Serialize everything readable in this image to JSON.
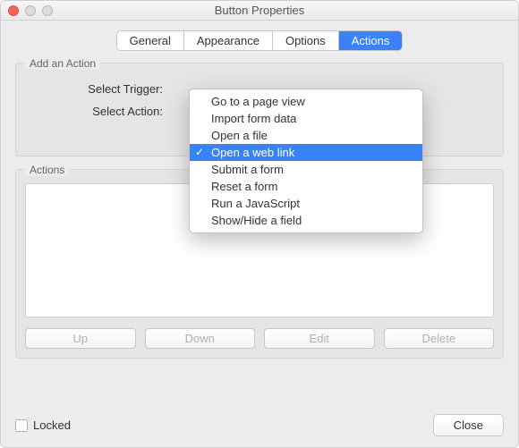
{
  "window": {
    "title": "Button Properties"
  },
  "tabs": {
    "items": [
      "General",
      "Appearance",
      "Options",
      "Actions"
    ],
    "active": 3
  },
  "add_action": {
    "group_label": "Add an Action",
    "trigger_label": "Select Trigger:",
    "action_label": "Select Action:"
  },
  "dropdown": {
    "options": [
      "Go to a page view",
      "Import form data",
      "Open a file",
      "Open a web link",
      "Submit a form",
      "Reset a form",
      "Run a JavaScript",
      "Show/Hide a field"
    ],
    "selected_index": 3
  },
  "actions_group": {
    "label": "Actions"
  },
  "buttons": {
    "up": "Up",
    "down": "Down",
    "edit": "Edit",
    "delete": "Delete"
  },
  "footer": {
    "locked_label": "Locked",
    "close_label": "Close"
  }
}
